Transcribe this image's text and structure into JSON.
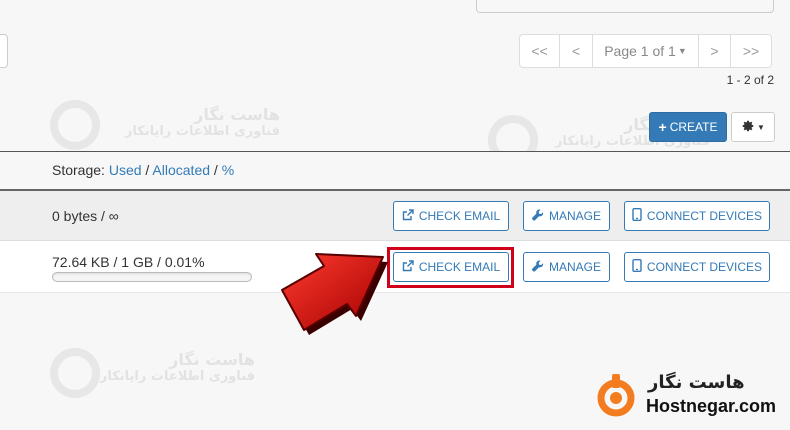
{
  "pagination": {
    "first": "<<",
    "prev": "<",
    "page_label": "Page 1 of 1",
    "next": ">",
    "last": ">>",
    "range": "1 - 2 of 2"
  },
  "toolbar": {
    "create_label": "CREATE",
    "create_icon": "plus-icon",
    "settings_icon": "gear-icon"
  },
  "table": {
    "header": {
      "storage_prefix": "Storage: ",
      "used": "Used",
      "sep1": " / ",
      "allocated": "Allocated",
      "sep2": " / ",
      "percent": "%"
    },
    "rows": [
      {
        "usage": "0 bytes / ∞",
        "check_email": "CHECK EMAIL",
        "manage": "MANAGE",
        "connect": "CONNECT DEVICES"
      },
      {
        "usage": "72.64 KB / 1 GB / 0.01%",
        "usage_fraction": 0.0001,
        "check_email": "CHECK EMAIL",
        "manage": "MANAGE",
        "connect": "CONNECT DEVICES"
      }
    ]
  },
  "watermark": {
    "name": "هاست نگار",
    "tagline": "فناوری اطلاعات رایانکار"
  },
  "brand": {
    "name": "هاست نگار",
    "domain": "Hostnegar.com",
    "accent": "#f47c20"
  },
  "colors": {
    "primary": "#337ab7",
    "highlight": "#d0021b",
    "arrow": "#cc0000"
  }
}
